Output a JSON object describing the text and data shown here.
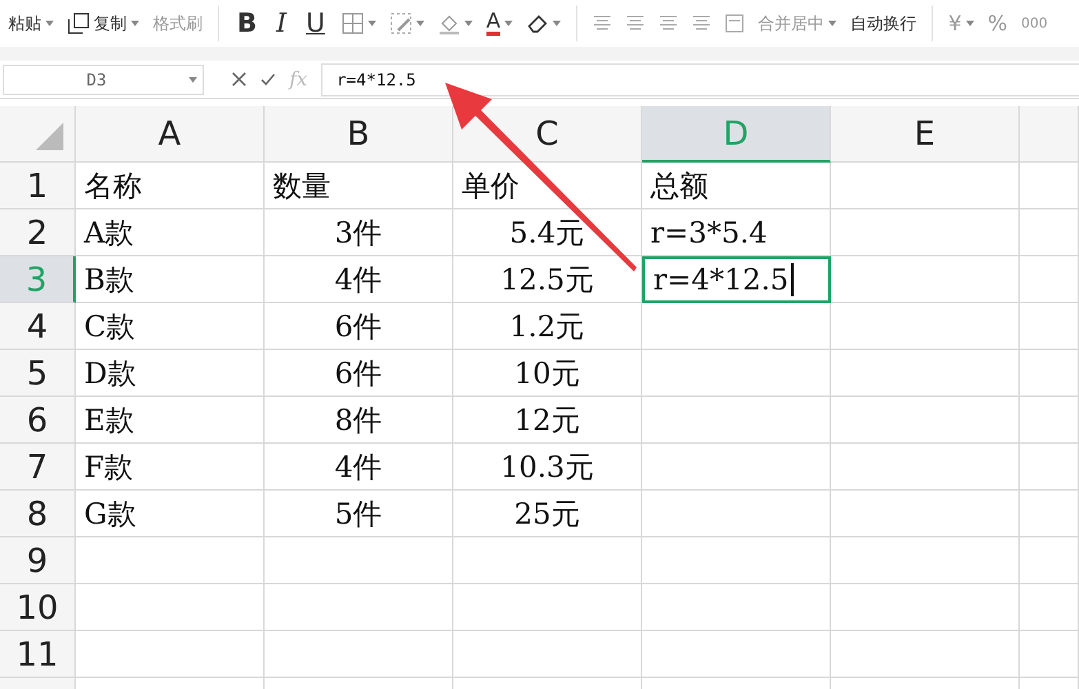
{
  "toolbar": {
    "paste": {
      "label": "粘贴"
    },
    "copy": {
      "label": "复制"
    },
    "format_painter": {
      "label": "格式刷",
      "disabled": true
    },
    "bold": "B",
    "italic": "I",
    "underline": "U",
    "font_color": "A",
    "merge_center": {
      "label": "合并居中",
      "disabled": true
    },
    "wrap_text": {
      "label": "自动换行",
      "disabled": false
    },
    "currency": "¥",
    "percent": "%",
    "thousands": "000"
  },
  "formula_bar": {
    "name_box": "D3",
    "fx_label": "fx",
    "value": "r=4*12.5"
  },
  "grid": {
    "editing": true,
    "columns": [
      {
        "label": "A",
        "selected": false
      },
      {
        "label": "B",
        "selected": false
      },
      {
        "label": "C",
        "selected": false
      },
      {
        "label": "D",
        "selected": true
      },
      {
        "label": "E",
        "selected": false
      }
    ],
    "rows": [
      {
        "label": "1",
        "selected": false,
        "cells": [
          "名称",
          "数量",
          "单价",
          "总额"
        ]
      },
      {
        "label": "2",
        "selected": false,
        "cells": [
          "A款",
          "3件",
          "5.4元",
          "r=3*5.4"
        ]
      },
      {
        "label": "3",
        "selected": true,
        "cells": [
          "B款",
          "4件",
          "12.5元",
          "r=4*12.5"
        ]
      },
      {
        "label": "4",
        "selected": false,
        "cells": [
          "C款",
          "6件",
          "1.2元"
        ]
      },
      {
        "label": "5",
        "selected": false,
        "cells": [
          "D款",
          "6件",
          "10元"
        ]
      },
      {
        "label": "6",
        "selected": false,
        "cells": [
          "E款",
          "8件",
          "12元"
        ]
      },
      {
        "label": "7",
        "selected": false,
        "cells": [
          "F款",
          "4件",
          "10.3元"
        ]
      },
      {
        "label": "8",
        "selected": false,
        "cells": [
          "G款",
          "5件",
          "25元"
        ]
      },
      {
        "label": "9",
        "selected": false
      },
      {
        "label": "10",
        "selected": false
      },
      {
        "label": "11",
        "selected": false
      }
    ]
  }
}
